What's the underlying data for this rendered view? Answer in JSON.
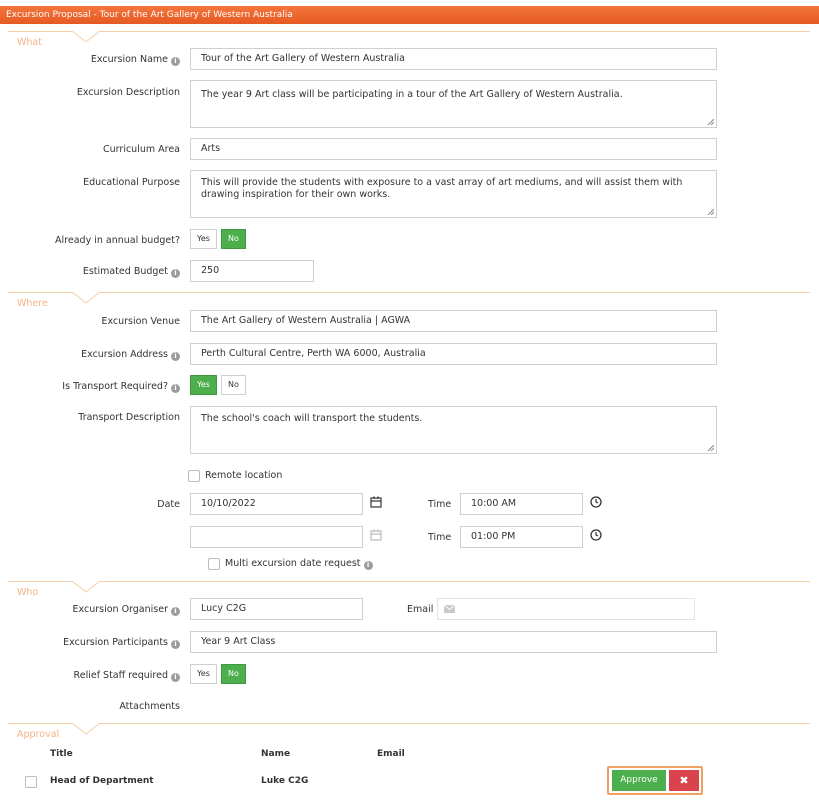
{
  "window": {
    "title": "Excursion Proposal - Tour of the Art Gallery of Western Australia"
  },
  "sections": {
    "what": "What",
    "where": "Where",
    "who": "Who",
    "approval": "Approval"
  },
  "what": {
    "name_label": "Excursion Name",
    "name_value": "Tour of the Art Gallery of Western Australia",
    "description_label": "Excursion Description",
    "description_value": "The year 9 Art class will be participating in a tour of the Art Gallery of Western Australia.",
    "curriculum_label": "Curriculum Area",
    "curriculum_value": "Arts",
    "purpose_label": "Educational Purpose",
    "purpose_value": "This will provide the students with exposure to a vast array of art mediums, and will assist them with drawing inspiration for their own works.",
    "budget_q_label": "Already in annual budget?",
    "budget_yes": "Yes",
    "budget_no": "No",
    "budget_selected": "No",
    "est_budget_label": "Estimated Budget",
    "est_budget_value": "250"
  },
  "where": {
    "venue_label": "Excursion Venue",
    "venue_value": "The Art Gallery of Western Australia | AGWA",
    "address_label": "Excursion Address",
    "address_value": "Perth Cultural Centre, Perth WA 6000, Australia",
    "transport_q_label": "Is Transport Required?",
    "transport_yes": "Yes",
    "transport_no": "No",
    "transport_selected": "Yes",
    "transport_desc_label": "Transport Description",
    "transport_desc_value": "The school's coach will transport the students.",
    "remote_label": "Remote location",
    "date_label": "Date",
    "start_date": "10/10/2022",
    "end_date": "",
    "time_label": "Time",
    "start_time": "10:00 AM",
    "end_time": "01:00 PM",
    "multi_label": "Multi excursion date request"
  },
  "who": {
    "organiser_label": "Excursion Organiser",
    "organiser_value": "Lucy C2G",
    "email_label": "Email",
    "email_value": "",
    "participants_label": "Excursion Participants",
    "participants_value": "Year 9 Art Class",
    "relief_label": "Relief Staff required",
    "relief_yes": "Yes",
    "relief_no": "No",
    "relief_selected": "No",
    "attachments_label": "Attachments"
  },
  "approval": {
    "headers": {
      "title": "Title",
      "name": "Name",
      "email": "Email"
    },
    "rows": [
      {
        "title": "Head of Department",
        "name": "Luke C2G",
        "email": ""
      }
    ],
    "approve_label": "Approve",
    "reject_icon": "close-icon"
  },
  "colors": {
    "accent": "#e65a22",
    "success": "#4cae4c",
    "danger": "#d9434b",
    "section": "#f5b389"
  }
}
